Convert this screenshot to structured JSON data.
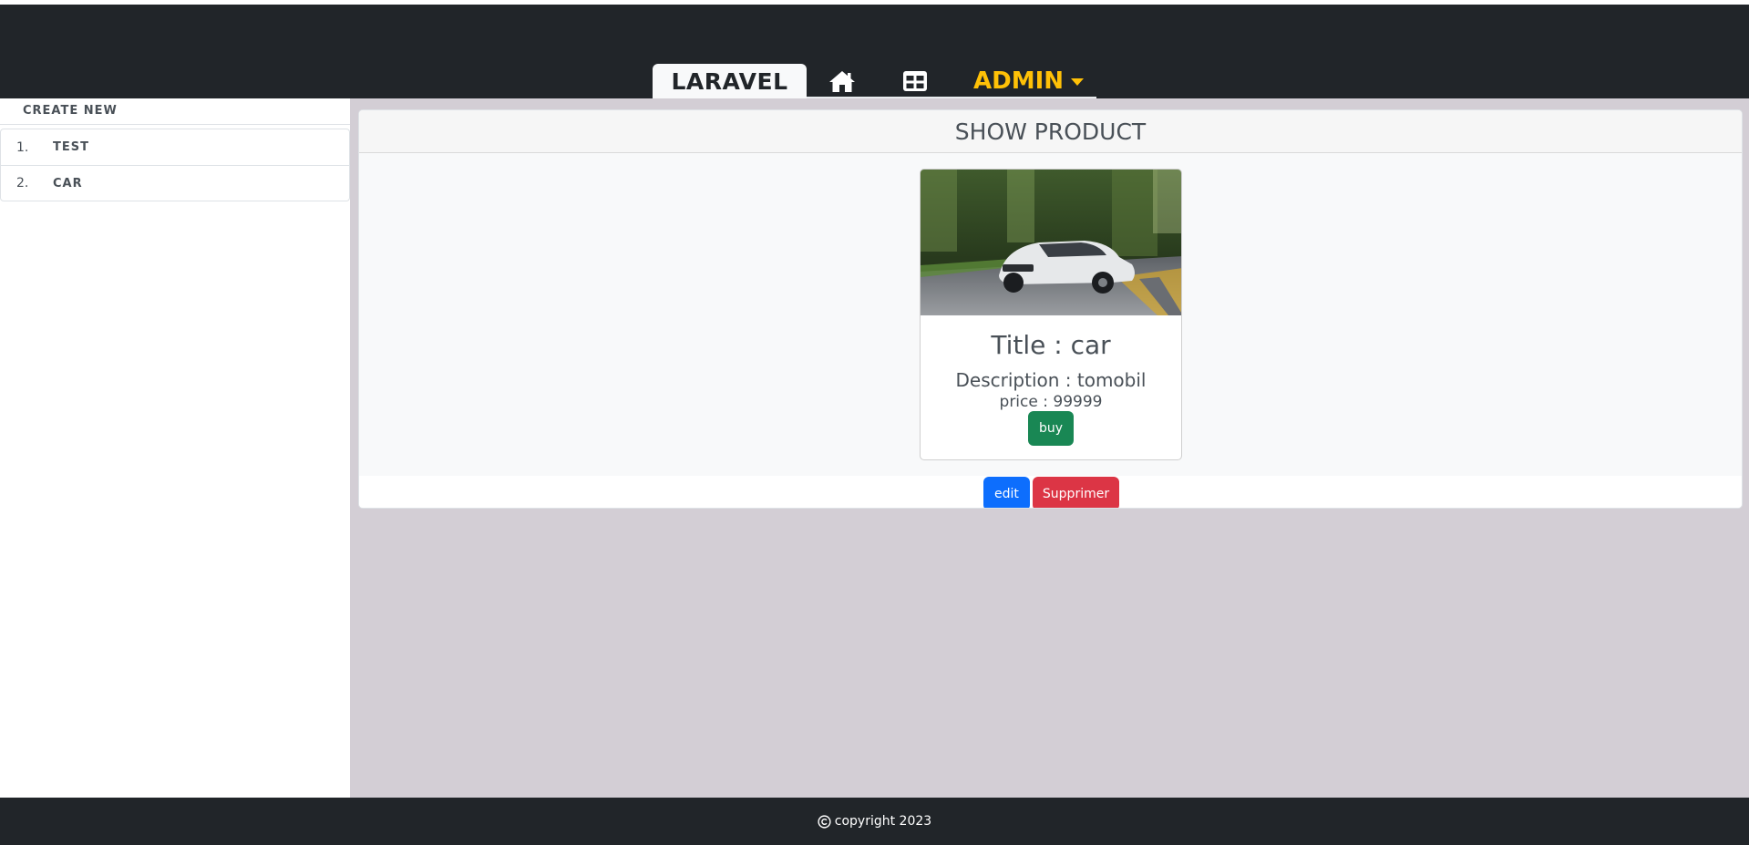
{
  "nav": {
    "brand": "LARAVEL",
    "home_icon": "home-icon",
    "grid_icon": "table-icon",
    "admin_label": "ADMIN",
    "brand_color": "#212529",
    "admin_color": "#ffc107"
  },
  "sidebar": {
    "create_label": "CREATE NEW",
    "items": [
      {
        "num": "1.",
        "label": "TEST"
      },
      {
        "num": "2.",
        "label": "CAR"
      }
    ]
  },
  "main": {
    "header": "SHOW PRODUCT",
    "product": {
      "title": "Title : car",
      "description": "Description : tomobil",
      "price": "price : 99999",
      "buy_label": "buy",
      "image_icon": "car-photo"
    },
    "edit_label": "edit",
    "delete_label": "Supprimer"
  },
  "footer": {
    "copyright_icon": "copyright-icon",
    "text": "copyright 2023"
  },
  "colors": {
    "navbar": "#212529",
    "main_bg": "#d3ced5",
    "buy": "#198754",
    "edit": "#0d6efd",
    "delete": "#dc3545"
  }
}
